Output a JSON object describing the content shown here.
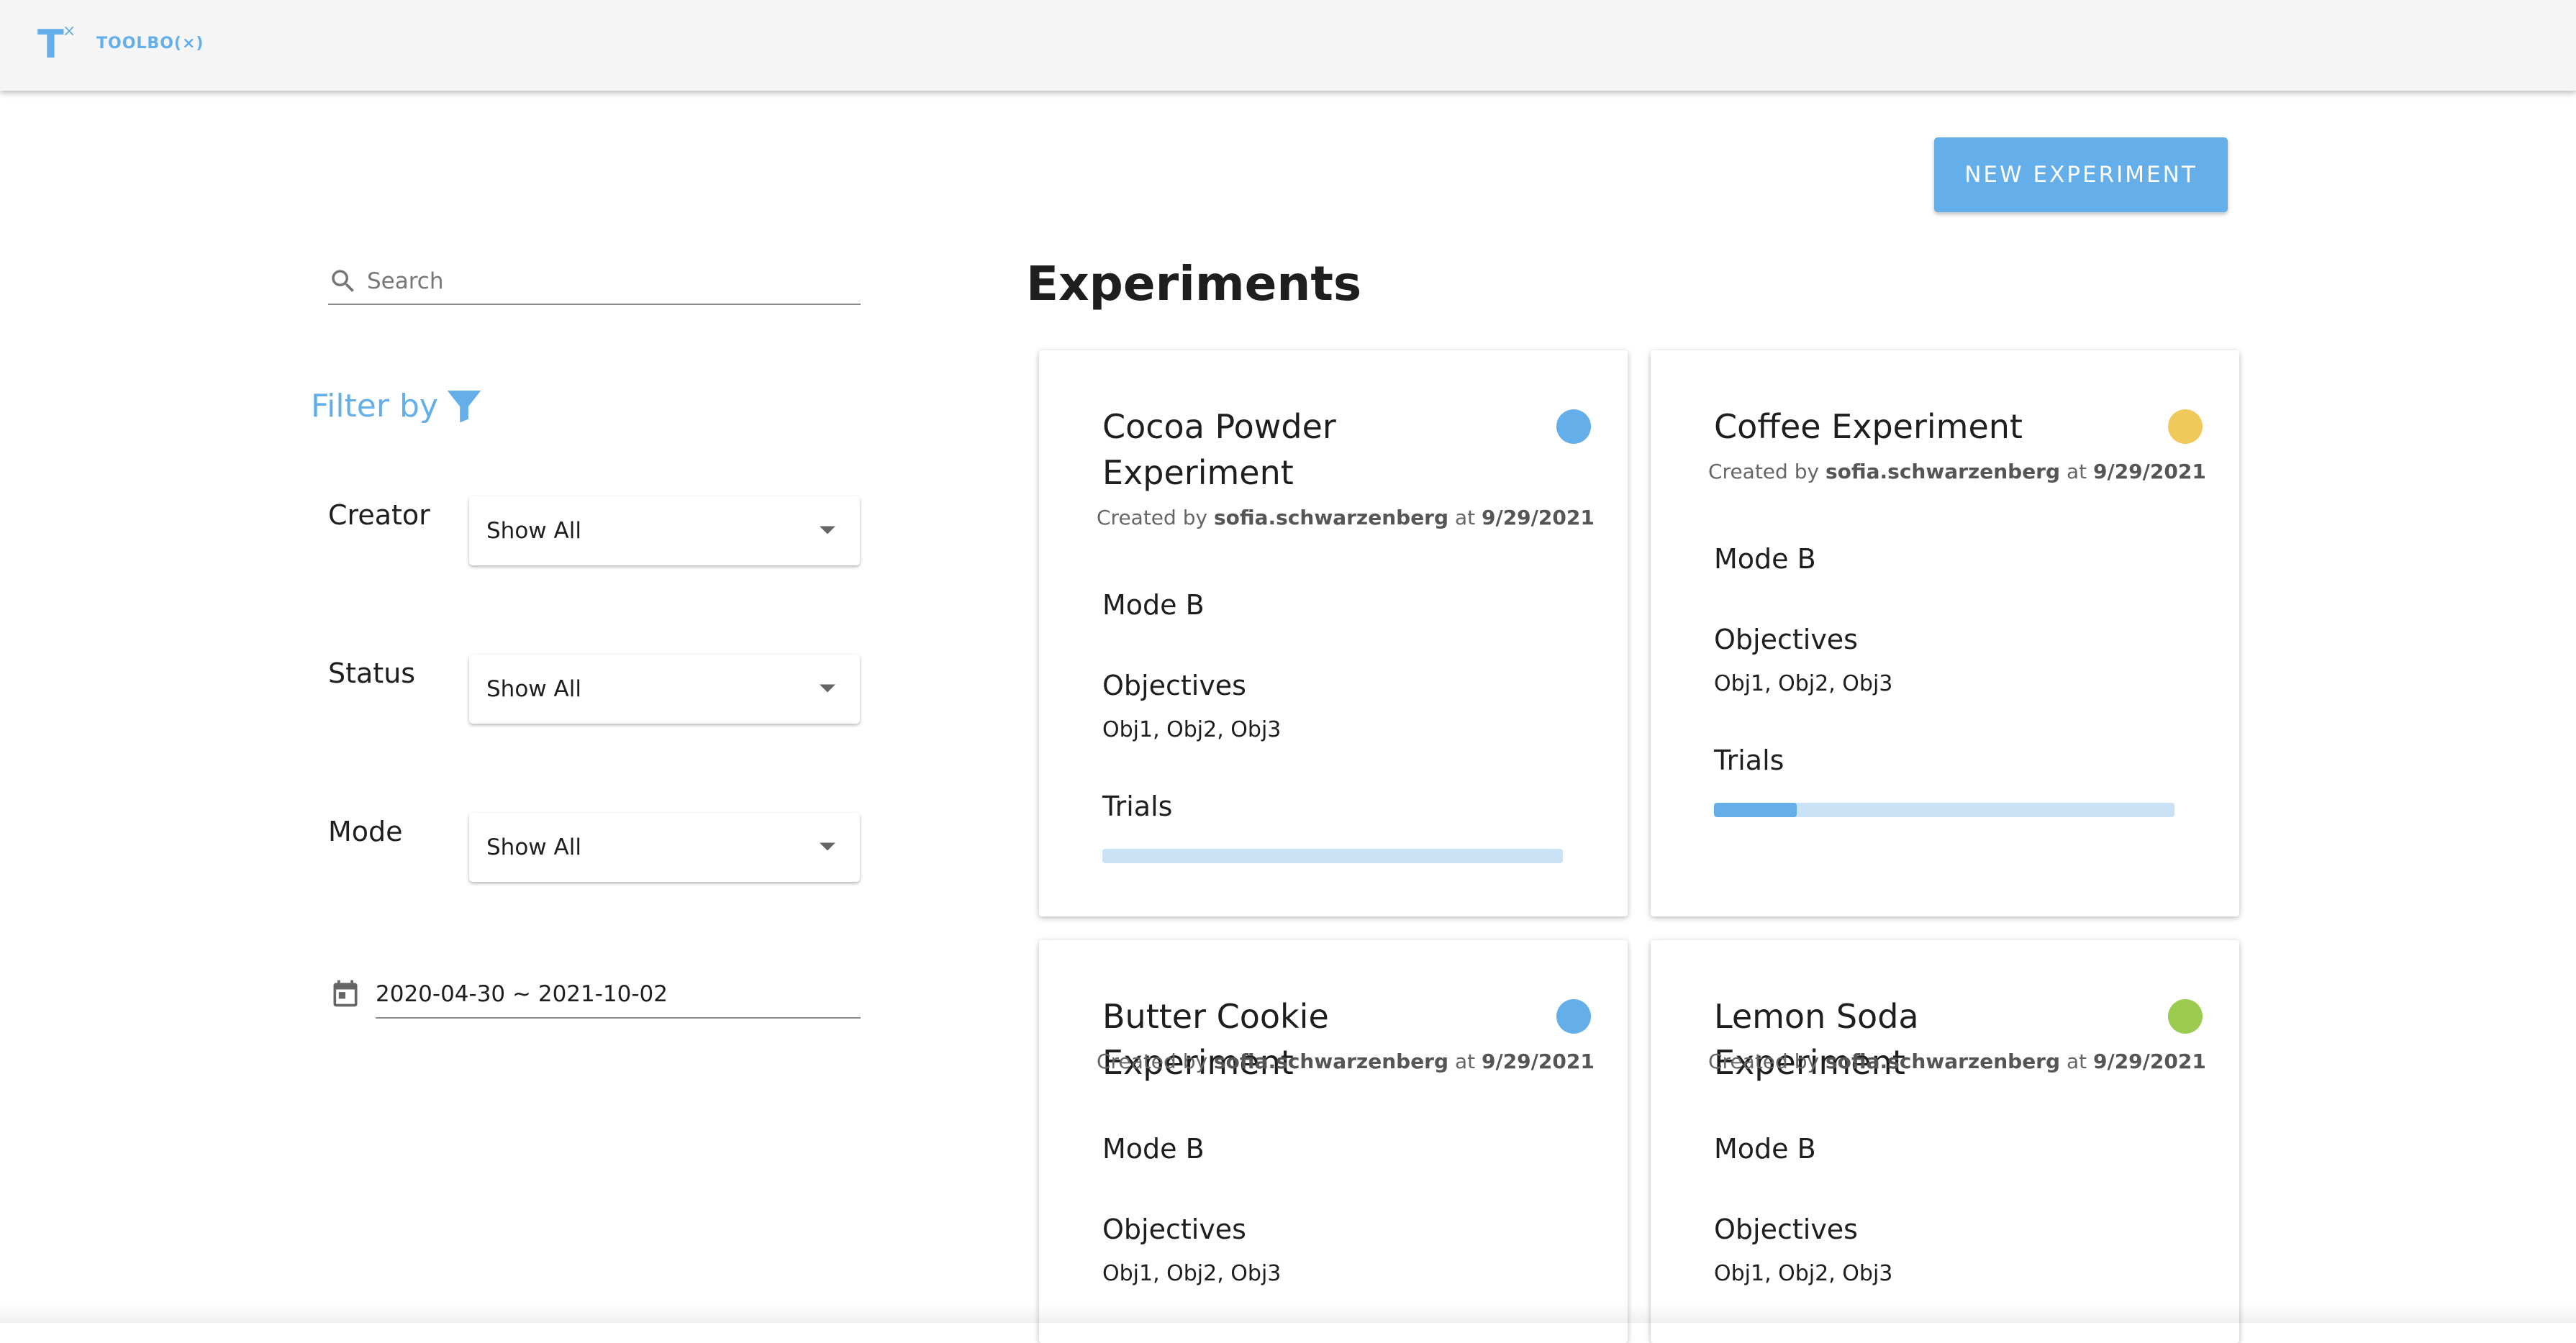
{
  "app": {
    "logo_letter": "T",
    "logo_sup": "×",
    "name": "TOOLBO(×)"
  },
  "toolbar": {
    "new_experiment_label": "NEW EXPERIMENT"
  },
  "search": {
    "placeholder": "Search",
    "value": ""
  },
  "filters": {
    "title": "Filter by",
    "creator": {
      "label": "Creator",
      "value": "Show All"
    },
    "status": {
      "label": "Status",
      "value": "Show All"
    },
    "mode": {
      "label": "Mode",
      "value": "Show All"
    },
    "date_range": "2020-04-30 ~ 2021-10-02"
  },
  "main": {
    "title": "Experiments",
    "cards": [
      {
        "title": "Cocoa Powder Experiment",
        "status_color": "#64aee9",
        "created_prefix": "Created by",
        "creator": "sofia.schwarzenberg",
        "at": "at",
        "date": "9/29/2021",
        "mode": "Mode B",
        "objectives_label": "Objectives",
        "objectives": "Obj1, Obj2, Obj3",
        "trials_label": "Trials",
        "trials_progress": 0
      },
      {
        "title": "Coffee Experiment",
        "status_color": "#f0c95a",
        "created_prefix": "Created by",
        "creator": "sofia.schwarzenberg",
        "at": "at",
        "date": "9/29/2021",
        "mode": "Mode B",
        "objectives_label": "Objectives",
        "objectives": "Obj1, Obj2, Obj3",
        "trials_label": "Trials",
        "trials_progress": 0.18
      },
      {
        "title": "Butter Cookie Experiment",
        "status_color": "#64aee9",
        "created_prefix": "Created by",
        "creator": "sofia.schwarzenberg",
        "at": "at",
        "date": "9/29/2021",
        "mode": "Mode B",
        "objectives_label": "Objectives",
        "objectives": "Obj1, Obj2, Obj3"
      },
      {
        "title": "Lemon Soda Experiment",
        "status_color": "#9bcb4f",
        "created_prefix": "Created by",
        "creator": "sofia.schwarzenberg",
        "at": "at",
        "date": "9/29/2021",
        "mode": "Mode B",
        "objectives_label": "Objectives",
        "objectives": "Obj1, Obj2, Obj3"
      }
    ]
  },
  "colors": {
    "accent": "#64aee9",
    "progress_track": "#c9e2f6",
    "status_blue": "#64aee9",
    "status_yellow": "#f0c95a",
    "status_green": "#9bcb4f"
  },
  "icons": {
    "search": "search-icon",
    "filter": "filter-funnel-icon",
    "dropdown": "dropdown-arrow-icon",
    "calendar": "calendar-icon"
  }
}
